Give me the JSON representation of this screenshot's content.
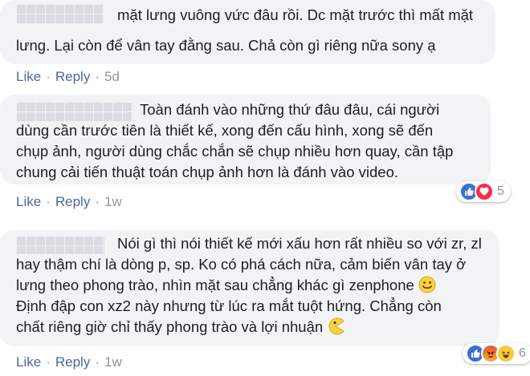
{
  "comments": [
    {
      "lines": [
        "mặt lưng vuông vức đâu rồi. Dc mặt trước thì mất mặt",
        "lưng. Lại còn để vân tay đằng sau. Chả còn gì riêng nữa sony ạ"
      ],
      "actions": {
        "like": "Like",
        "reply": "Reply",
        "time": "5d"
      }
    },
    {
      "lines": [
        "Toàn đánh vào những thứ đâu đâu, cái người",
        "dùng cần trước tiên là thiết kế, xong đến cấu hình, xong sẽ đến",
        "chụp ảnh, người dùng chắc chắn sẽ chụp nhiều hơn quay, cần tập",
        "chung cải tiến thuật toán chụp ảnh hơn là đánh vào video."
      ],
      "actions": {
        "like": "Like",
        "reply": "Reply",
        "time": "1w"
      },
      "reactions": {
        "icons": [
          "like-reaction-icon",
          "love-reaction-icon"
        ],
        "count": "5"
      }
    },
    {
      "lines": [
        "Nói gì thì nói thiết kế mới xấu hơn rất nhiều so với zr, zl",
        "hay thậm chí là dòng p, sp. Ko có phá cách nữa, cảm biến vân tay ở",
        "lưng theo phong trào, nhìn mặt sau chẳng khác gì zenphone",
        "Định đập con xz2 này nhưng từ lúc ra mắt tuột hứng. Chẳng còn",
        "chất riêng giờ chỉ thấy phong trào và lợi nhuận"
      ],
      "actions": {
        "like": "Like",
        "reply": "Reply",
        "time": "1w"
      },
      "reactions": {
        "icons": [
          "like-reaction-icon",
          "angry-reaction-icon",
          "haha-reaction-icon"
        ],
        "count": "6"
      }
    }
  ],
  "colors": {
    "bubble": "#f2f3f5",
    "link": "#4b67a1",
    "meta": "#90949c",
    "text": "#1c1e21"
  }
}
